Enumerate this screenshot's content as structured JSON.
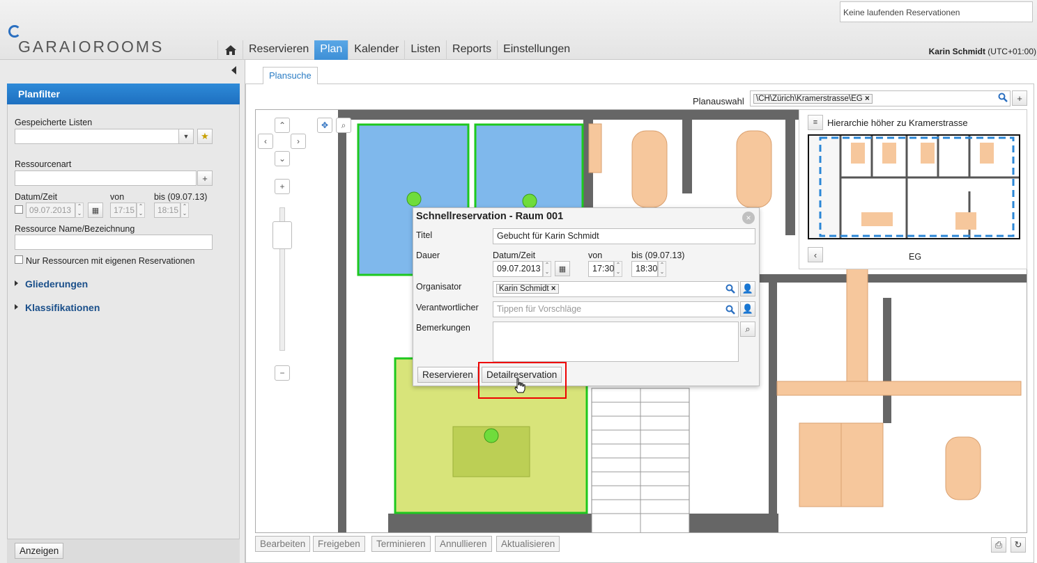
{
  "app": {
    "logo_text": "GARAIOROOMS",
    "running_reservations": "Keine laufenden Reservationen",
    "user_name": "Karin Schmidt",
    "timezone": "(UTC+01:00)"
  },
  "nav": {
    "items": [
      {
        "label": "Reservieren",
        "active": false
      },
      {
        "label": "Plan",
        "active": true
      },
      {
        "label": "Kalender",
        "active": false
      },
      {
        "label": "Listen",
        "active": false
      },
      {
        "label": "Reports",
        "active": false
      },
      {
        "label": "Einstellungen",
        "active": false
      }
    ]
  },
  "sidebar": {
    "title": "Planfilter",
    "saved_lists_label": "Gespeicherte Listen",
    "resource_type_label": "Ressourcenart",
    "datetime_label": "Datum/Zeit",
    "from_label": "von",
    "to_label": "bis (09.07.13)",
    "date_value": "09.07.2013",
    "from_value": "17:15",
    "to_value": "18:15",
    "resource_name_label": "Ressource Name/Bezeichnung",
    "own_reservations_label": "Nur Ressourcen mit eigenen Reservationen",
    "sections": [
      "Gliederungen",
      "Klassifikationen"
    ],
    "show_button": "Anzeigen"
  },
  "main": {
    "tab": "Plansuche",
    "plan_selection_label": "Planauswahl",
    "plan_selection_value": "\\CH\\Zürich\\Kramerstrasse\\EG",
    "hierarchy_link": "Hierarchie höher zu Kramerstrasse",
    "floor_label": "EG"
  },
  "quick_reservation": {
    "title": "Schnellreservation - Raum 001",
    "titel_label": "Titel",
    "titel_value": "Gebucht für Karin Schmidt",
    "dauer_label": "Dauer",
    "datetime_label": "Datum/Zeit",
    "from_label": "von",
    "to_label": "bis (09.07.13)",
    "date_value": "09.07.2013",
    "from_value": "17:30",
    "to_value": "18:30",
    "organizer_label": "Organisator",
    "organizer_value": "Karin Schmidt",
    "responsible_label": "Verantwortlicher",
    "responsible_placeholder": "Tippen für Vorschläge",
    "remarks_label": "Bemerkungen",
    "reserve_button": "Reservieren",
    "detail_button": "Detailreservation"
  },
  "bottom_buttons": [
    "Bearbeiten",
    "Freigeben",
    "Terminieren",
    "Annullieren",
    "Aktualisieren"
  ],
  "colors": {
    "accent_blue": "#3d8fd6",
    "room_blue": "#7fb8ec",
    "room_yellow": "#d8e47a",
    "room_border_green": "#1ec81e",
    "highlight_red": "#e00000",
    "furniture_orange": "#f6c79c"
  },
  "icons": [
    "home-icon",
    "calendar-icon",
    "search-icon",
    "person-icon",
    "zoom-icon",
    "move-icon",
    "refresh-icon",
    "print-icon"
  ]
}
